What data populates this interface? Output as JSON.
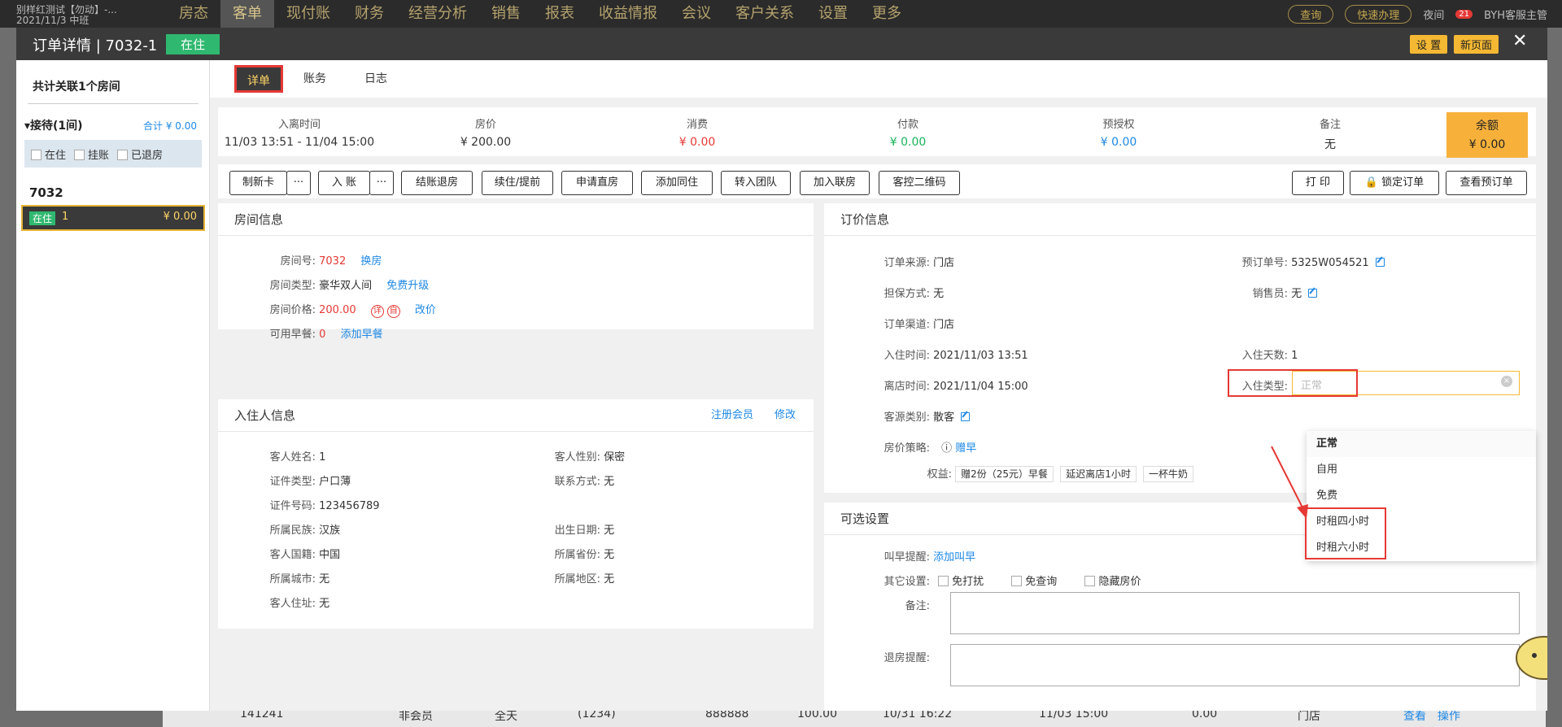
{
  "topbar": {
    "hotel_name": "别样红测试【勿动】-...",
    "shift": "2021/11/3 中班",
    "nav": [
      "房态",
      "客单",
      "现付账",
      "财务",
      "经营分析",
      "销售",
      "报表",
      "收益情报",
      "会议",
      "客户关系",
      "设置",
      "更多"
    ],
    "search_label": "查询",
    "quick_label": "快速办理",
    "night_label": "夜间",
    "badge_count": "21",
    "user": "BYH客服主管"
  },
  "behind_row": {
    "code": "141241",
    "member": "非会员",
    "day": "全天",
    "extra": "(1234)",
    "phone": "888888",
    "price": "100.00",
    "checkin": "10/31 16:22",
    "checkout": "11/03 15:00",
    "amount": "0.00",
    "source": "门店",
    "view": "查看",
    "op": "操作"
  },
  "modal": {
    "title": "订单详情 | 7032-1",
    "status": "在住",
    "settings_label": "设 置",
    "new_page_label": "新页面",
    "close_symbol": "✕"
  },
  "sidebar": {
    "title": "共计关联1个房间",
    "group_label": "接待(1间)",
    "group_total": "合计 ¥ 0.00",
    "filters": [
      "在住",
      "挂账",
      "已退房"
    ],
    "room_no": "7032",
    "room_status": "在住",
    "room_guest": "1",
    "room_amount": "¥ 0.00"
  },
  "tabs": [
    "详单",
    "账务",
    "日志"
  ],
  "summary": {
    "stay_label": "入离时间",
    "stay_value": "11/03 13:51 - 11/04 15:00",
    "rate_label": "房价",
    "rate_value": "¥ 200.00",
    "consume_label": "消费",
    "consume_value": "¥ 0.00",
    "pay_label": "付款",
    "pay_value": "¥ 0.00",
    "preauth_label": "预授权",
    "preauth_value": "¥ 0.00",
    "note_label": "备注",
    "note_value": "无",
    "balance_label": "余额",
    "balance_value": "¥ 0.00"
  },
  "toolbar": {
    "make_card": "制新卡",
    "more": "···",
    "post": "入 账",
    "checkout": "结账退房",
    "extend": "续住/提前",
    "apply_direct": "申请直房",
    "add_guest": "添加同住",
    "to_group": "转入团队",
    "join_linked": "加入联房",
    "qrcode": "客控二维码",
    "print": "打 印",
    "lock": "锁定订单",
    "view_booking": "查看预订单"
  },
  "room_info": {
    "title": "房间信息",
    "room_no_label": "房间号:",
    "room_no": "7032",
    "change_room": "换房",
    "type_label": "房间类型:",
    "type": "豪华双人间",
    "upgrade": "免费升级",
    "price_label": "房间价格:",
    "price": "200.00",
    "badge1": "详",
    "badge2": "自",
    "change_price": "改价",
    "breakfast_label": "可用早餐:",
    "breakfast": "0",
    "add_breakfast": "添加早餐"
  },
  "guest_info": {
    "title": "入住人信息",
    "register": "注册会员",
    "edit": "修改",
    "name_label": "客人姓名:",
    "name": "1",
    "gender_label": "客人性别:",
    "gender": "保密",
    "idtype_label": "证件类型:",
    "idtype": "户口薄",
    "contact_label": "联系方式:",
    "contact": "无",
    "idno_label": "证件号码:",
    "idno": "123456789",
    "ethnic_label": "所属民族:",
    "ethnic": "汉族",
    "birth_label": "出生日期:",
    "birth": "无",
    "nation_label": "客人国籍:",
    "nation": "中国",
    "province_label": "所属省份:",
    "province": "无",
    "city_label": "所属城市:",
    "city": "无",
    "district_label": "所属地区:",
    "district": "无",
    "address_label": "客人住址:",
    "address": "无"
  },
  "order_info": {
    "title": "订价信息",
    "source_label": "订单来源:",
    "source": "门店",
    "booking_no_label": "预订单号:",
    "booking_no": "5325W054521",
    "guarantee_label": "担保方式:",
    "guarantee": "无",
    "sales_label": "销售员:",
    "sales": "无",
    "channel_label": "订单渠道:",
    "channel": "门店",
    "checkin_label": "入住时间:",
    "checkin": "2021/11/03 13:51",
    "days_label": "入住天数:",
    "days": "1",
    "checkout_label": "离店时间:",
    "checkout": "2021/11/04 15:00",
    "stay_type_label": "入住类型:",
    "stay_type_placeholder": "正常",
    "guest_type_label": "客源类别:",
    "guest_type": "散客",
    "strategy_label": "房价策略:",
    "strategy": "赠早",
    "benefit_label": "权益:",
    "benefits": [
      "赠2份（25元）早餐",
      "延迟离店1小时",
      "一杯牛奶"
    ]
  },
  "stay_type_options": [
    "正常",
    "自用",
    "免费",
    "时租四小时",
    "时租六小时"
  ],
  "optional": {
    "title": "可选设置",
    "wakeup_label": "叫早提醒:",
    "wakeup_action": "添加叫早",
    "other_label": "其它设置:",
    "options": [
      "免打扰",
      "免查询",
      "隐藏房价"
    ],
    "remark_label": "备注:",
    "checkout_remind_label": "退房提醒:"
  },
  "colors": {
    "accent": "#f5b833",
    "status_green": "#2fb86f",
    "link": "#1e88e5",
    "alert": "#e53935"
  }
}
